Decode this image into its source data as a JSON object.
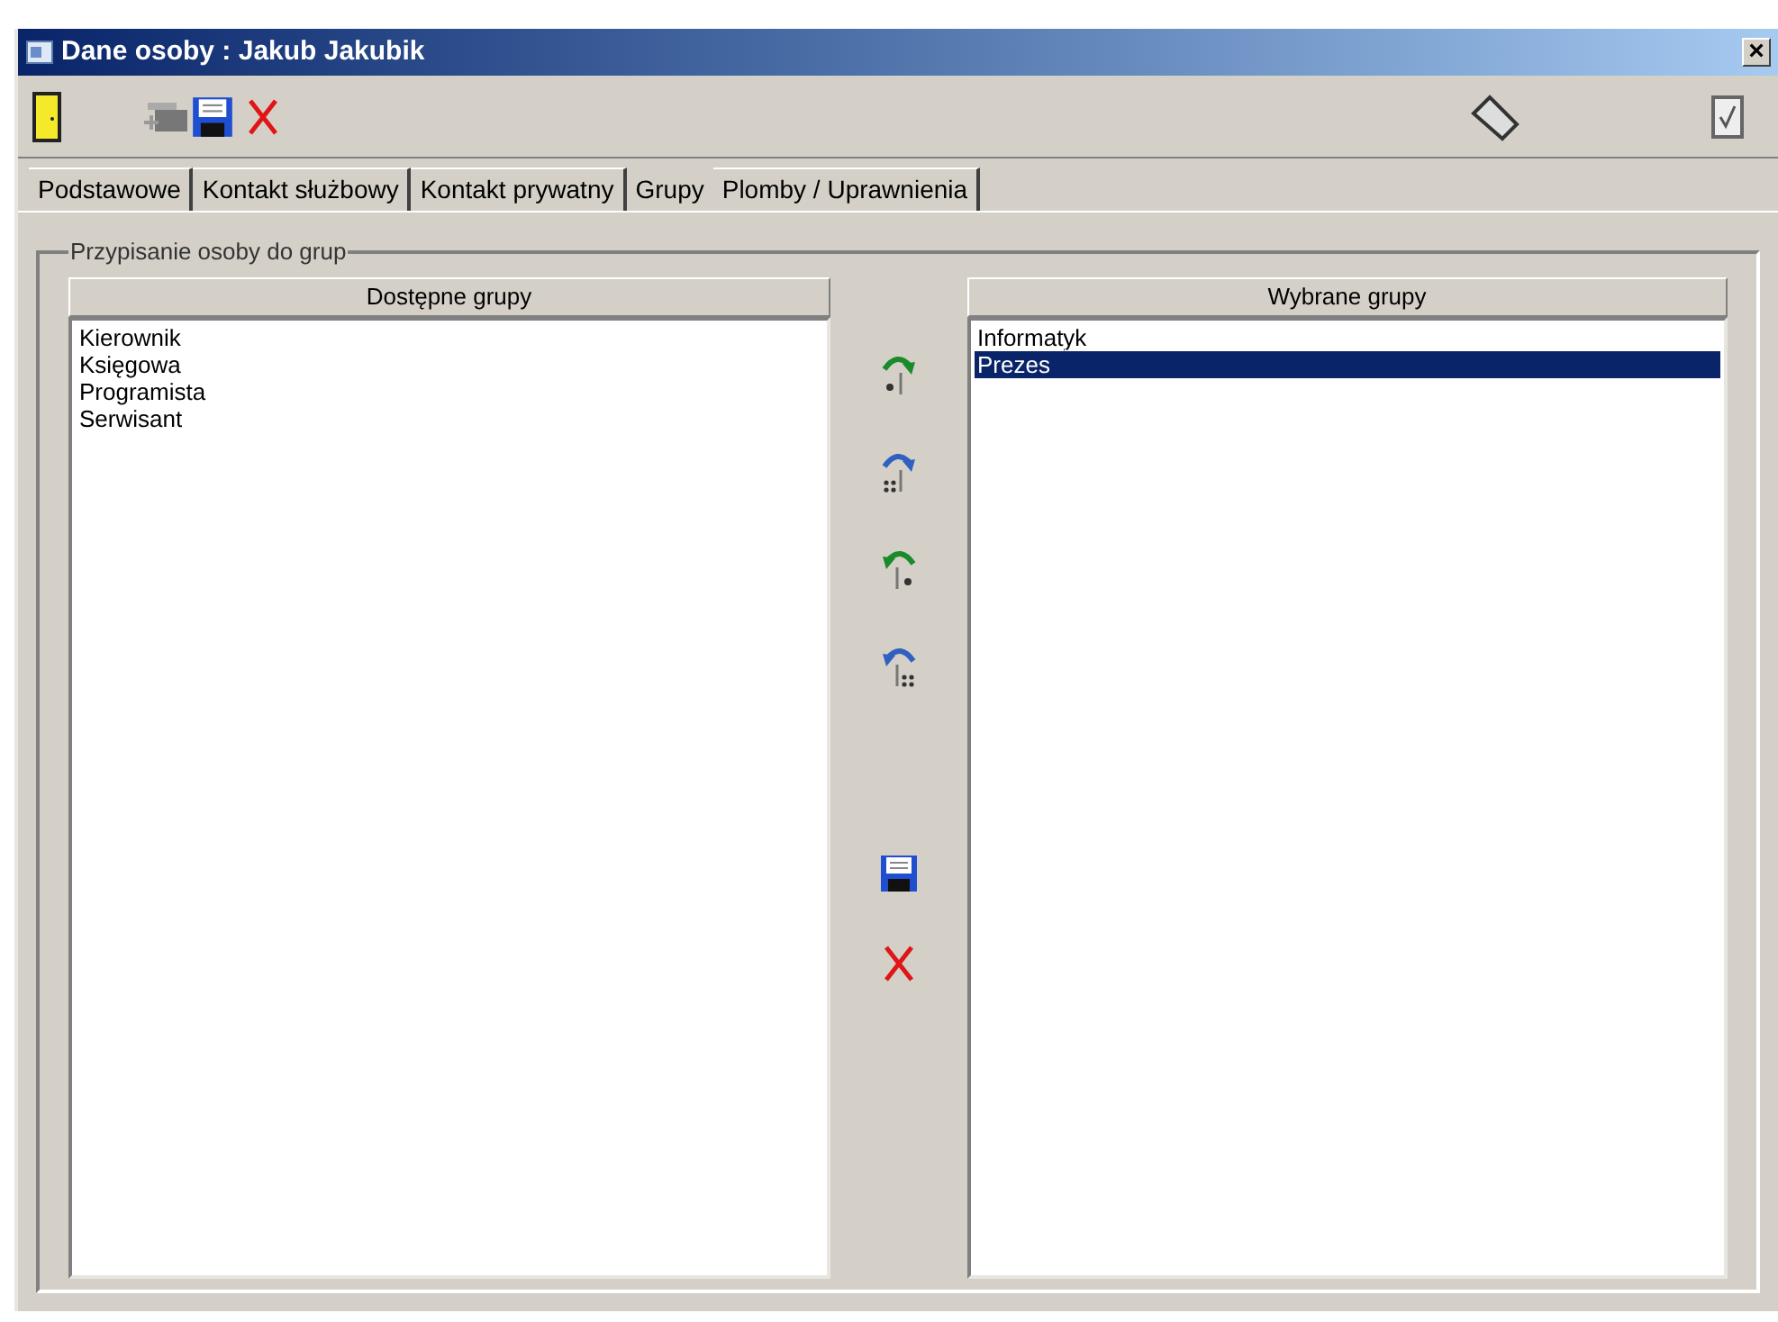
{
  "window": {
    "title": "Dane osoby : Jakub Jakubik",
    "close": "×"
  },
  "tabs": [
    {
      "label": "Podstawowe",
      "selected": false
    },
    {
      "label": "Kontakt służbowy",
      "selected": false
    },
    {
      "label": "Kontakt prywatny",
      "selected": false
    },
    {
      "label": "Grupy",
      "selected": true
    },
    {
      "label": "Plomby / Uprawnienia",
      "selected": false
    }
  ],
  "group": {
    "title": "Przypisanie osoby do grup"
  },
  "available": {
    "header": "Dostępne grupy",
    "items": [
      {
        "label": "Kierownik",
        "selected": false
      },
      {
        "label": "Księgowa",
        "selected": false
      },
      {
        "label": "Programista",
        "selected": false
      },
      {
        "label": "Serwisant",
        "selected": false
      }
    ]
  },
  "chosen": {
    "header": "Wybrane grupy",
    "items": [
      {
        "label": "Informatyk",
        "selected": false
      },
      {
        "label": "Prezes",
        "selected": true
      }
    ]
  }
}
